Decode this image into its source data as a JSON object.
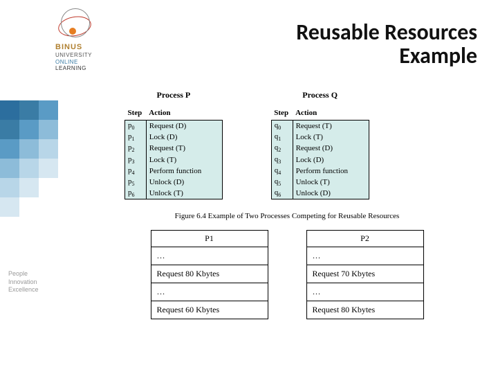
{
  "logo": {
    "line1": "BINUS",
    "line2": "UNIVERSITY",
    "line3": "ONLINE",
    "line4": "LEARNING"
  },
  "tagline": {
    "l1": "People",
    "l2": "Innovation",
    "l3": "Excellence"
  },
  "title": {
    "l1": "Reusable Resources",
    "l2": "Example"
  },
  "processP": {
    "name": "Process P",
    "headStep": "Step",
    "headAction": "Action",
    "rows": [
      {
        "step": "p",
        "idx": "0",
        "action": "Request (D)"
      },
      {
        "step": "p",
        "idx": "1",
        "action": "Lock (D)"
      },
      {
        "step": "p",
        "idx": "2",
        "action": "Request (T)"
      },
      {
        "step": "p",
        "idx": "3",
        "action": "Lock (T)"
      },
      {
        "step": "p",
        "idx": "4",
        "action": "Perform function"
      },
      {
        "step": "p",
        "idx": "5",
        "action": "Unlock (D)"
      },
      {
        "step": "p",
        "idx": "6",
        "action": "Unlock (T)"
      }
    ]
  },
  "processQ": {
    "name": "Process Q",
    "headStep": "Step",
    "headAction": "Action",
    "rows": [
      {
        "step": "q",
        "idx": "0",
        "action": "Request (T)"
      },
      {
        "step": "q",
        "idx": "1",
        "action": "Lock (T)"
      },
      {
        "step": "q",
        "idx": "2",
        "action": "Request (D)"
      },
      {
        "step": "q",
        "idx": "3",
        "action": "Lock (D)"
      },
      {
        "step": "q",
        "idx": "4",
        "action": "Perform function"
      },
      {
        "step": "q",
        "idx": "5",
        "action": "Unlock (T)"
      },
      {
        "step": "q",
        "idx": "6",
        "action": "Unlock (D)"
      }
    ]
  },
  "figCaption": "Figure 6.4   Example of Two Processes Competing for Reusable Resources",
  "reqP1": {
    "name": "P1",
    "rows": [
      "…",
      "Request 80 Kbytes",
      "…",
      "Request 60 Kbytes"
    ]
  },
  "reqP2": {
    "name": "P2",
    "rows": [
      "…",
      "Request 70 Kbytes",
      "…",
      "Request 80 Kbytes"
    ]
  }
}
